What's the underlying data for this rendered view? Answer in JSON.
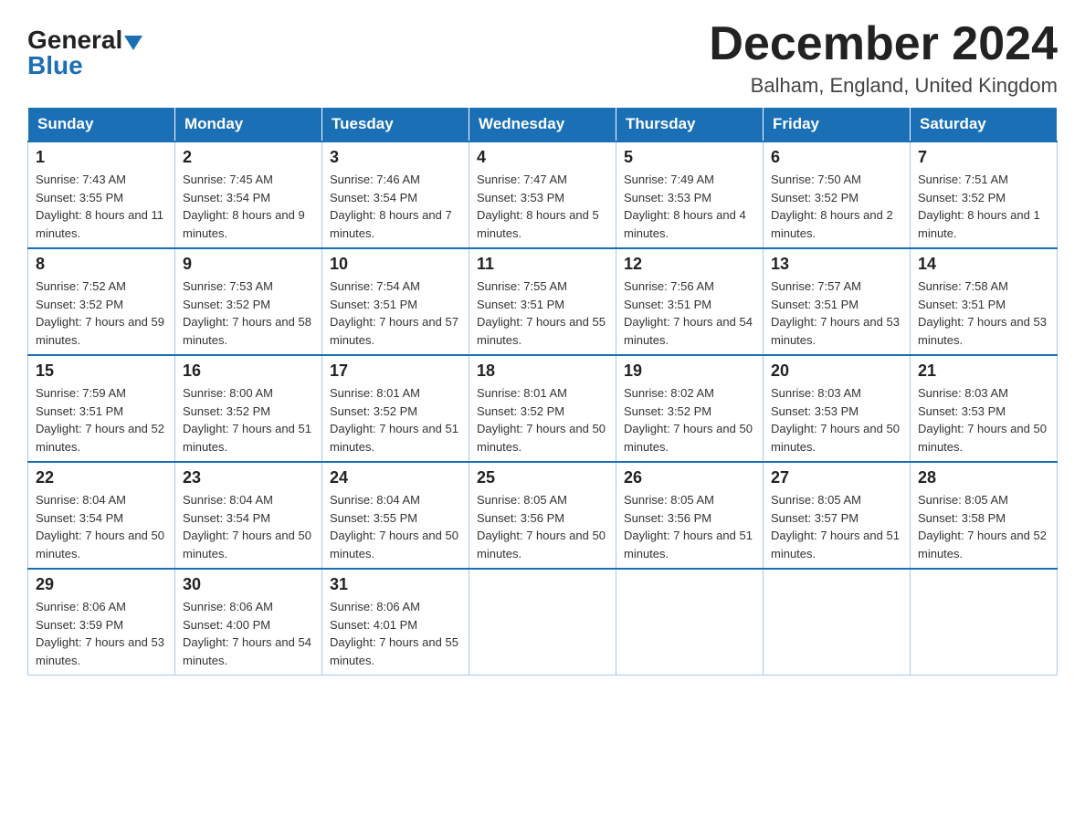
{
  "logo": {
    "general": "General",
    "blue": "Blue"
  },
  "header": {
    "title": "December 2024",
    "location": "Balham, England, United Kingdom"
  },
  "weekdays": [
    "Sunday",
    "Monday",
    "Tuesday",
    "Wednesday",
    "Thursday",
    "Friday",
    "Saturday"
  ],
  "weeks": [
    [
      {
        "day": "1",
        "sunrise": "7:43 AM",
        "sunset": "3:55 PM",
        "daylight": "8 hours and 11 minutes."
      },
      {
        "day": "2",
        "sunrise": "7:45 AM",
        "sunset": "3:54 PM",
        "daylight": "8 hours and 9 minutes."
      },
      {
        "day": "3",
        "sunrise": "7:46 AM",
        "sunset": "3:54 PM",
        "daylight": "8 hours and 7 minutes."
      },
      {
        "day": "4",
        "sunrise": "7:47 AM",
        "sunset": "3:53 PM",
        "daylight": "8 hours and 5 minutes."
      },
      {
        "day": "5",
        "sunrise": "7:49 AM",
        "sunset": "3:53 PM",
        "daylight": "8 hours and 4 minutes."
      },
      {
        "day": "6",
        "sunrise": "7:50 AM",
        "sunset": "3:52 PM",
        "daylight": "8 hours and 2 minutes."
      },
      {
        "day": "7",
        "sunrise": "7:51 AM",
        "sunset": "3:52 PM",
        "daylight": "8 hours and 1 minute."
      }
    ],
    [
      {
        "day": "8",
        "sunrise": "7:52 AM",
        "sunset": "3:52 PM",
        "daylight": "7 hours and 59 minutes."
      },
      {
        "day": "9",
        "sunrise": "7:53 AM",
        "sunset": "3:52 PM",
        "daylight": "7 hours and 58 minutes."
      },
      {
        "day": "10",
        "sunrise": "7:54 AM",
        "sunset": "3:51 PM",
        "daylight": "7 hours and 57 minutes."
      },
      {
        "day": "11",
        "sunrise": "7:55 AM",
        "sunset": "3:51 PM",
        "daylight": "7 hours and 55 minutes."
      },
      {
        "day": "12",
        "sunrise": "7:56 AM",
        "sunset": "3:51 PM",
        "daylight": "7 hours and 54 minutes."
      },
      {
        "day": "13",
        "sunrise": "7:57 AM",
        "sunset": "3:51 PM",
        "daylight": "7 hours and 53 minutes."
      },
      {
        "day": "14",
        "sunrise": "7:58 AM",
        "sunset": "3:51 PM",
        "daylight": "7 hours and 53 minutes."
      }
    ],
    [
      {
        "day": "15",
        "sunrise": "7:59 AM",
        "sunset": "3:51 PM",
        "daylight": "7 hours and 52 minutes."
      },
      {
        "day": "16",
        "sunrise": "8:00 AM",
        "sunset": "3:52 PM",
        "daylight": "7 hours and 51 minutes."
      },
      {
        "day": "17",
        "sunrise": "8:01 AM",
        "sunset": "3:52 PM",
        "daylight": "7 hours and 51 minutes."
      },
      {
        "day": "18",
        "sunrise": "8:01 AM",
        "sunset": "3:52 PM",
        "daylight": "7 hours and 50 minutes."
      },
      {
        "day": "19",
        "sunrise": "8:02 AM",
        "sunset": "3:52 PM",
        "daylight": "7 hours and 50 minutes."
      },
      {
        "day": "20",
        "sunrise": "8:03 AM",
        "sunset": "3:53 PM",
        "daylight": "7 hours and 50 minutes."
      },
      {
        "day": "21",
        "sunrise": "8:03 AM",
        "sunset": "3:53 PM",
        "daylight": "7 hours and 50 minutes."
      }
    ],
    [
      {
        "day": "22",
        "sunrise": "8:04 AM",
        "sunset": "3:54 PM",
        "daylight": "7 hours and 50 minutes."
      },
      {
        "day": "23",
        "sunrise": "8:04 AM",
        "sunset": "3:54 PM",
        "daylight": "7 hours and 50 minutes."
      },
      {
        "day": "24",
        "sunrise": "8:04 AM",
        "sunset": "3:55 PM",
        "daylight": "7 hours and 50 minutes."
      },
      {
        "day": "25",
        "sunrise": "8:05 AM",
        "sunset": "3:56 PM",
        "daylight": "7 hours and 50 minutes."
      },
      {
        "day": "26",
        "sunrise": "8:05 AM",
        "sunset": "3:56 PM",
        "daylight": "7 hours and 51 minutes."
      },
      {
        "day": "27",
        "sunrise": "8:05 AM",
        "sunset": "3:57 PM",
        "daylight": "7 hours and 51 minutes."
      },
      {
        "day": "28",
        "sunrise": "8:05 AM",
        "sunset": "3:58 PM",
        "daylight": "7 hours and 52 minutes."
      }
    ],
    [
      {
        "day": "29",
        "sunrise": "8:06 AM",
        "sunset": "3:59 PM",
        "daylight": "7 hours and 53 minutes."
      },
      {
        "day": "30",
        "sunrise": "8:06 AM",
        "sunset": "4:00 PM",
        "daylight": "7 hours and 54 minutes."
      },
      {
        "day": "31",
        "sunrise": "8:06 AM",
        "sunset": "4:01 PM",
        "daylight": "7 hours and 55 minutes."
      },
      null,
      null,
      null,
      null
    ]
  ],
  "labels": {
    "sunrise": "Sunrise:",
    "sunset": "Sunset:",
    "daylight": "Daylight:"
  }
}
